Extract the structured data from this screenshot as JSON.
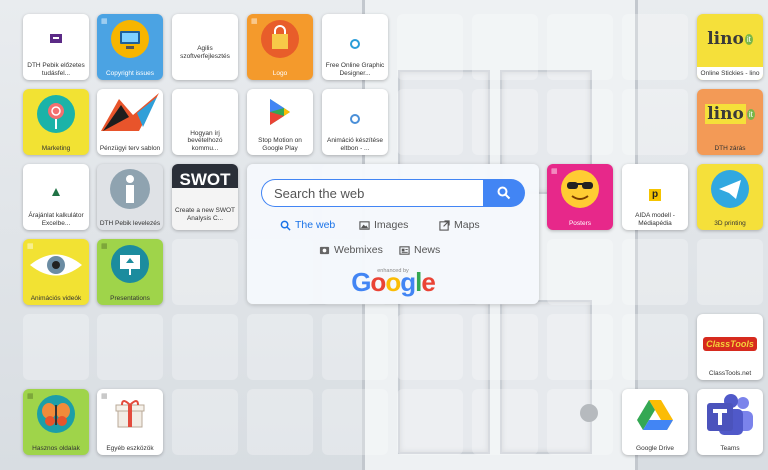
{
  "tiles": [
    {
      "id": "t1",
      "label": "DTH Pebik előzetes tudásfel...",
      "icon": "document-icon"
    },
    {
      "id": "t2",
      "label": "Copyright issues",
      "icon": "monitor-user-icon"
    },
    {
      "id": "t3",
      "label": "Agilis szoftverfejlesztés",
      "icon": ""
    },
    {
      "id": "t4",
      "label": "Logo",
      "icon": "shopping-bag-icon"
    },
    {
      "id": "t5",
      "label": "Free Online Graphic Designer...",
      "icon": "design-icon"
    },
    {
      "id": "t6",
      "label": "Online Stickies - lino",
      "icon": "lino-logo"
    },
    {
      "id": "t7",
      "label": "Marketing",
      "icon": "lollipop-icon"
    },
    {
      "id": "t8",
      "label": "Pénzügyi terv sablon",
      "icon": "chart-arrow-icon"
    },
    {
      "id": "t9",
      "label": "Hogyan írj bevételhozó kommu...",
      "icon": ""
    },
    {
      "id": "t10",
      "label": "Stop Motion on Google Play",
      "icon": "google-play-icon"
    },
    {
      "id": "t11",
      "label": "Animáció készítése eltbon - ...",
      "icon": "animation-icon"
    },
    {
      "id": "t12",
      "label": "DTH zárás",
      "icon": "lino-logo"
    },
    {
      "id": "t13",
      "label": "Árajánlat kalkulátor Excelbe...",
      "icon": "excel-icon"
    },
    {
      "id": "t14",
      "label": "DTH Pebik levelezés",
      "icon": "info-icon"
    },
    {
      "id": "t15",
      "label": "Create a new SWOT Analysis C...",
      "icon": "swot-icon"
    },
    {
      "id": "t16",
      "label": "Posters",
      "icon": "sunglasses-emoji-icon"
    },
    {
      "id": "t17",
      "label": "AIDA modell - Médiapédia",
      "icon": "p-icon"
    },
    {
      "id": "t18",
      "label": "3D printing",
      "icon": "telegram-icon"
    },
    {
      "id": "t19",
      "label": "Animációs videók",
      "icon": "eye-icon"
    },
    {
      "id": "t20",
      "label": "Presentations",
      "icon": "presentation-icon"
    },
    {
      "id": "t21",
      "label": "ClassTools.net",
      "icon": "classtools-logo"
    },
    {
      "id": "t22",
      "label": "Hasznos oldalak",
      "icon": "butterfly-icon"
    },
    {
      "id": "t23",
      "label": "Egyéb eszközök",
      "icon": "gift-icon"
    },
    {
      "id": "t24",
      "label": "Google Drive",
      "icon": "google-drive-icon"
    },
    {
      "id": "t25",
      "label": "Teams",
      "icon": "teams-icon"
    }
  ],
  "logo_texts": {
    "lino": "lino",
    "lino_it": "it",
    "swot": "SWOT",
    "classtools": "ClassTools"
  },
  "search": {
    "placeholder": "Search the web",
    "options": [
      {
        "label": "The web",
        "icon": "search-icon",
        "active": true
      },
      {
        "label": "Images",
        "icon": "image-icon",
        "active": false
      },
      {
        "label": "Maps",
        "icon": "map-icon",
        "active": false
      },
      {
        "label": "Webmixes",
        "icon": "webmix-icon",
        "active": false
      },
      {
        "label": "News",
        "icon": "news-icon",
        "active": false
      }
    ],
    "enhanced_by": "enhanced by",
    "google_letters": [
      "G",
      "o",
      "o",
      "g",
      "l",
      "e"
    ]
  },
  "colors": {
    "accent": "#4285f4",
    "google": [
      "#4285f4",
      "#ea4335",
      "#fbbc05",
      "#4285f4",
      "#34a853",
      "#ea4335"
    ]
  }
}
